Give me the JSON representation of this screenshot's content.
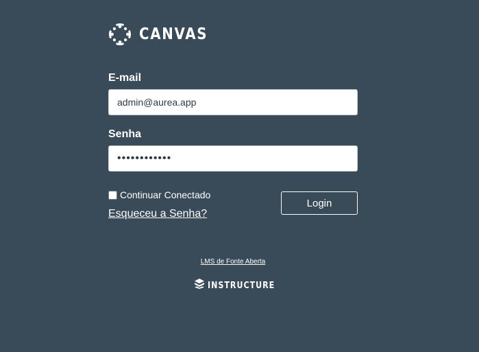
{
  "brand": {
    "name": "CANVAS",
    "icon": "canvas-logo-icon"
  },
  "form": {
    "email_label": "E-mail",
    "email_value": "admin@aurea.app",
    "password_label": "Senha",
    "password_value": "••••••••••••",
    "remember_label": "Continuar Conectado",
    "remember_checked": false,
    "forgot_label": "Esqueceu a Senha?",
    "login_label": "Login"
  },
  "footer": {
    "link_label": "LMS de Fonte Aberta",
    "vendor_name": "INSTRUCTURE",
    "vendor_icon": "instructure-logo-icon"
  },
  "colors": {
    "background": "#394b58",
    "text": "#ffffff",
    "input_background": "#ffffff"
  }
}
